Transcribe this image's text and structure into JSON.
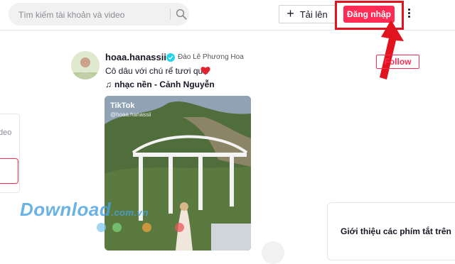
{
  "search": {
    "placeholder": "Tìm kiếm tài khoản và video"
  },
  "header": {
    "upload_label": "Tải lên",
    "login_label": "Đăng nhập"
  },
  "post": {
    "username": "hoaa.hanassii",
    "display_name": "Đào Lê Phương Hoa",
    "caption": "Cô dâu với chú rể tươi quá",
    "music": "nhạc nền - Cảnh Nguyễn",
    "follow_label": "Follow",
    "video_brand": "TikTok",
    "video_handle": "@hoaa.hanassii"
  },
  "left_panel": {
    "text": "deo"
  },
  "right_panel": {
    "title": "Giới thiệu các phím tắt trên"
  },
  "watermark": {
    "text": "Download",
    "suffix": ".com.vn"
  },
  "colors": {
    "accent": "#fe2c55",
    "highlight": "#e1131f",
    "watermark": "#4aa3df",
    "dots": [
      "#7ec8f0",
      "#7fd17f",
      "#f2a03d",
      "#e85a5a"
    ]
  }
}
